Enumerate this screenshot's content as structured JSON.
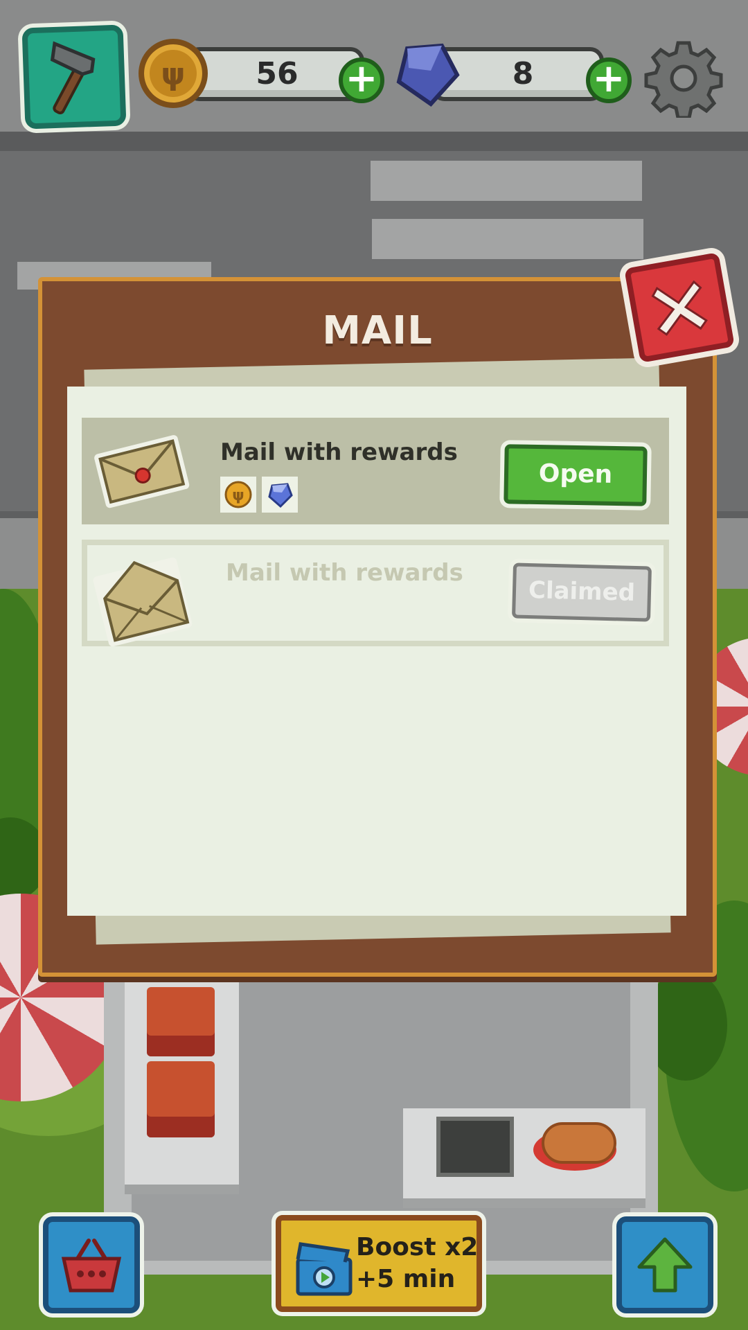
{
  "hud": {
    "coins": "56",
    "gems": "8"
  },
  "modal": {
    "title": "MAIL",
    "mails": [
      {
        "title": "Mail with rewards",
        "state": "unread",
        "rewards": [
          "coin-icon",
          "gem-icon"
        ],
        "button": "Open"
      },
      {
        "title": "Mail with rewards",
        "state": "claimed",
        "rewards": [],
        "button": "Claimed"
      }
    ]
  },
  "bottom": {
    "boost_line1": "Boost x2",
    "boost_line2": "+5 min"
  },
  "colors": {
    "accent_green": "#55b73b",
    "close_red": "#d9383c",
    "frame_brown": "#7d4a2f",
    "boost_yellow": "#e0b62c"
  }
}
